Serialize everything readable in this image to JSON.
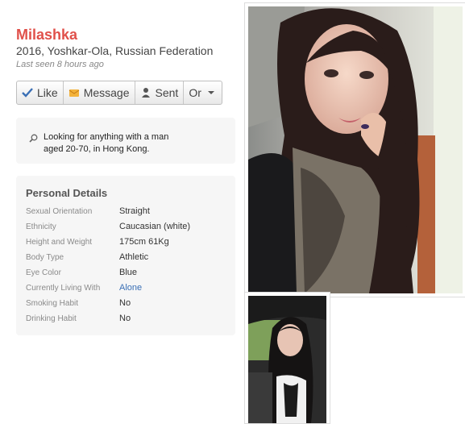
{
  "profile": {
    "name": "Milashka",
    "subtitle": "2016, Yoshkar-Ola, Russian Federation",
    "last_seen": "Last seen 8 hours ago"
  },
  "actions": {
    "like": "Like",
    "message": "Message",
    "sent": "Sent",
    "or": "Or"
  },
  "looking_for": "Looking for anything with a man aged 20-70, in Hong Kong.",
  "details": {
    "title": "Personal Details",
    "rows": [
      {
        "label": "Sexual Orientation",
        "value": "Straight"
      },
      {
        "label": "Ethnicity",
        "value": "Caucasian (white)"
      },
      {
        "label": "Height and Weight",
        "value": "175cm 61Kg"
      },
      {
        "label": "Body Type",
        "value": "Athletic"
      },
      {
        "label": "Eye Color",
        "value": "Blue"
      },
      {
        "label": "Currently Living With",
        "value": "Alone"
      },
      {
        "label": "Smoking Habit",
        "value": "No"
      },
      {
        "label": "Drinking Habit",
        "value": "No"
      }
    ]
  },
  "colors": {
    "name": "#e0504a",
    "link": "#3a6fb5",
    "panel_bg": "#f6f6f6"
  },
  "icons": {
    "like": "checkmark-icon",
    "message": "envelope-icon",
    "sent": "person-icon",
    "or": "caret-down-icon",
    "search": "magnifier-icon"
  }
}
